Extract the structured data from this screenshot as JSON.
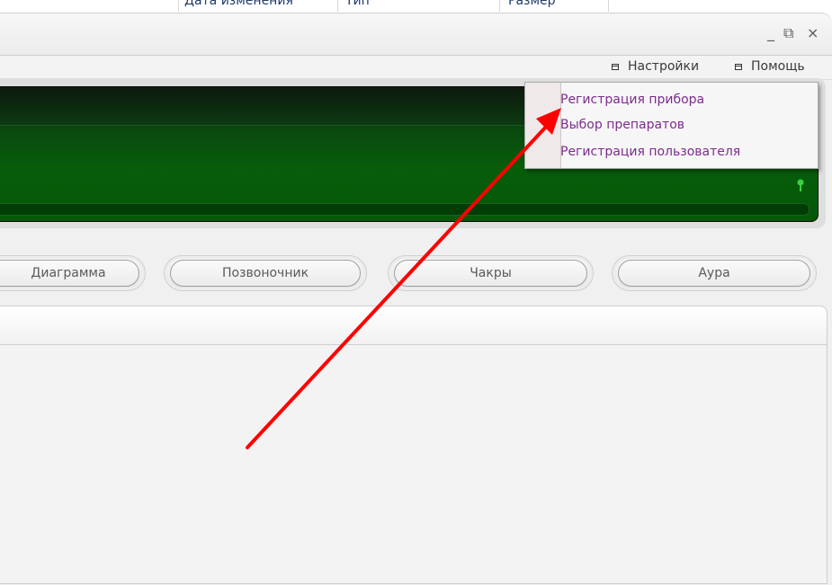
{
  "background_columns": {
    "date_modified": "Дата изменения",
    "type": "Тип",
    "size": "Размер"
  },
  "window_controls": {
    "minimize_symbol": "_",
    "restore_symbol": "⧉",
    "close_symbol": "×"
  },
  "menubar": {
    "settings_label": "Настройки",
    "help_label": "Помощь"
  },
  "dropdown": {
    "items": [
      {
        "label": "Регистрация прибора"
      },
      {
        "label": "Выбор препаратов"
      },
      {
        "label": "Регистрация пользователя"
      }
    ],
    "text_color": "#7d2c8e"
  },
  "tabs": [
    {
      "label": "Диаграмма"
    },
    {
      "label": "Позвоночник"
    },
    {
      "label": "Чакры"
    },
    {
      "label": "Аура"
    }
  ],
  "meter": {
    "display_color": "#075d0a",
    "indicator_color": "#39d23c"
  },
  "annotation": {
    "arrow_color": "#ff0000"
  }
}
